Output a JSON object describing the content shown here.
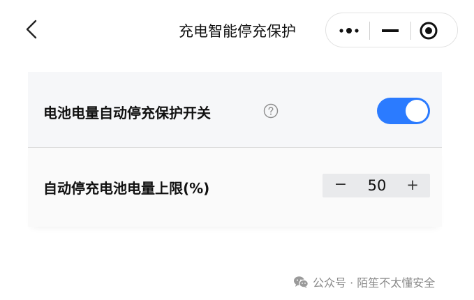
{
  "header": {
    "title": "充电智能停充保护",
    "back_icon": "chevron-left-icon",
    "capsule": {
      "more_icon": "more-dots-icon",
      "minimize_icon": "minimize-icon",
      "close_icon": "target-close-icon"
    }
  },
  "settings": {
    "auto_stop": {
      "label": "电池电量自动停充保护开关",
      "help_icon": "question-circle-icon",
      "enabled": true,
      "toggle_color": "#2b7bff"
    },
    "limit": {
      "label": "自动停充电池电量上限(%)",
      "minus": "−",
      "value": "50",
      "plus": "+"
    }
  },
  "watermark": {
    "icon": "wechat-icon",
    "text": "公众号 · 陌笙不太懂安全"
  }
}
